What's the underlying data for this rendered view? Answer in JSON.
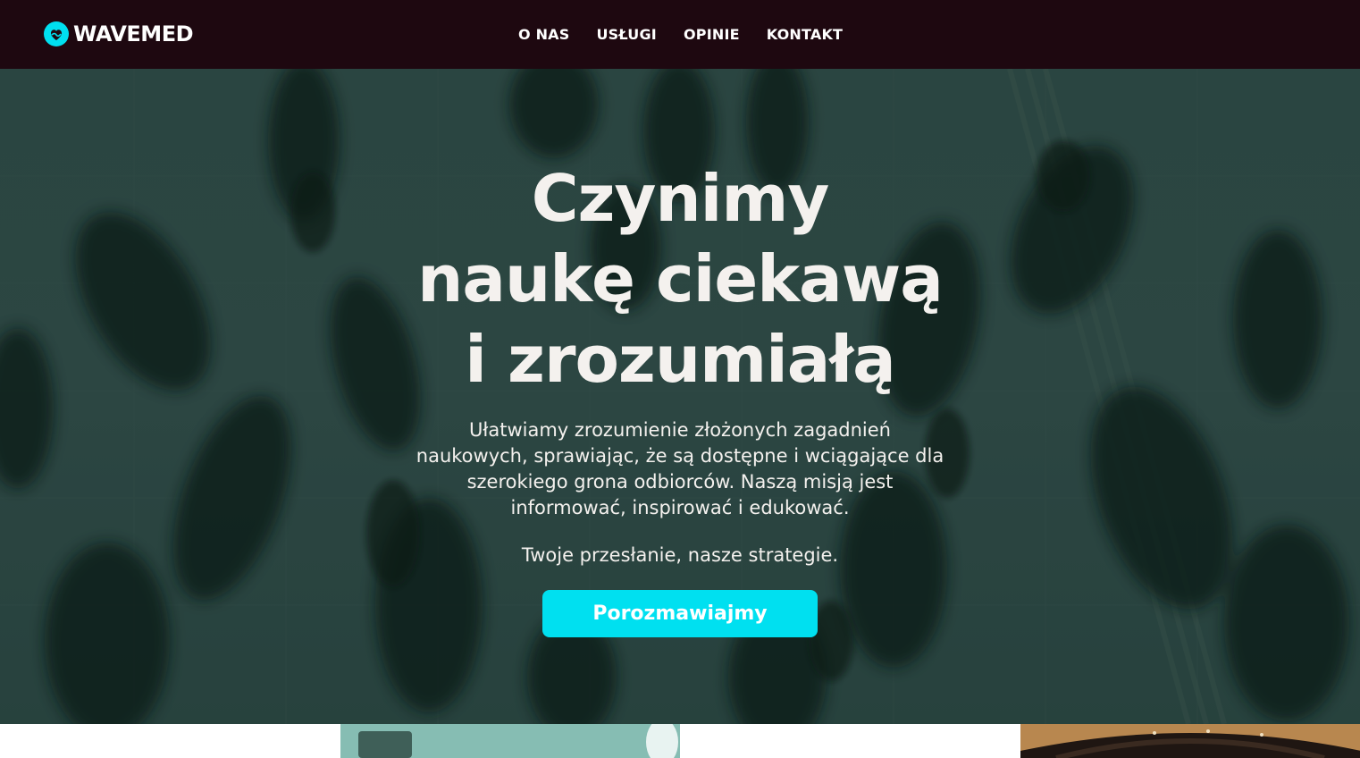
{
  "header": {
    "logo_text": "WAVEMED",
    "nav": [
      {
        "label": "O NAS"
      },
      {
        "label": "USŁUGI"
      },
      {
        "label": "OPINIE"
      },
      {
        "label": "KONTAKT"
      }
    ]
  },
  "hero": {
    "title_lines": [
      "Czynimy",
      "naukę ciekawą",
      "i zrozumiałą"
    ],
    "description": "Ułatwiamy zrozumienie złożonych zagadnień naukowych, sprawiając, że są dostępne i wciągające dla szerokiego grona odbiorców. Naszą misją jest informować, inspirować i edukować.",
    "tagline": "Twoje przesłanie, nasze strategie.",
    "cta_label": "Porozmawiajmy"
  },
  "colors": {
    "header_bg": "#1e0810",
    "accent": "#00e0f0",
    "hero_tint": "#2f4541",
    "text_light": "#f4f1ee"
  },
  "icons": {
    "logo": "wave-heart-logo-icon"
  }
}
